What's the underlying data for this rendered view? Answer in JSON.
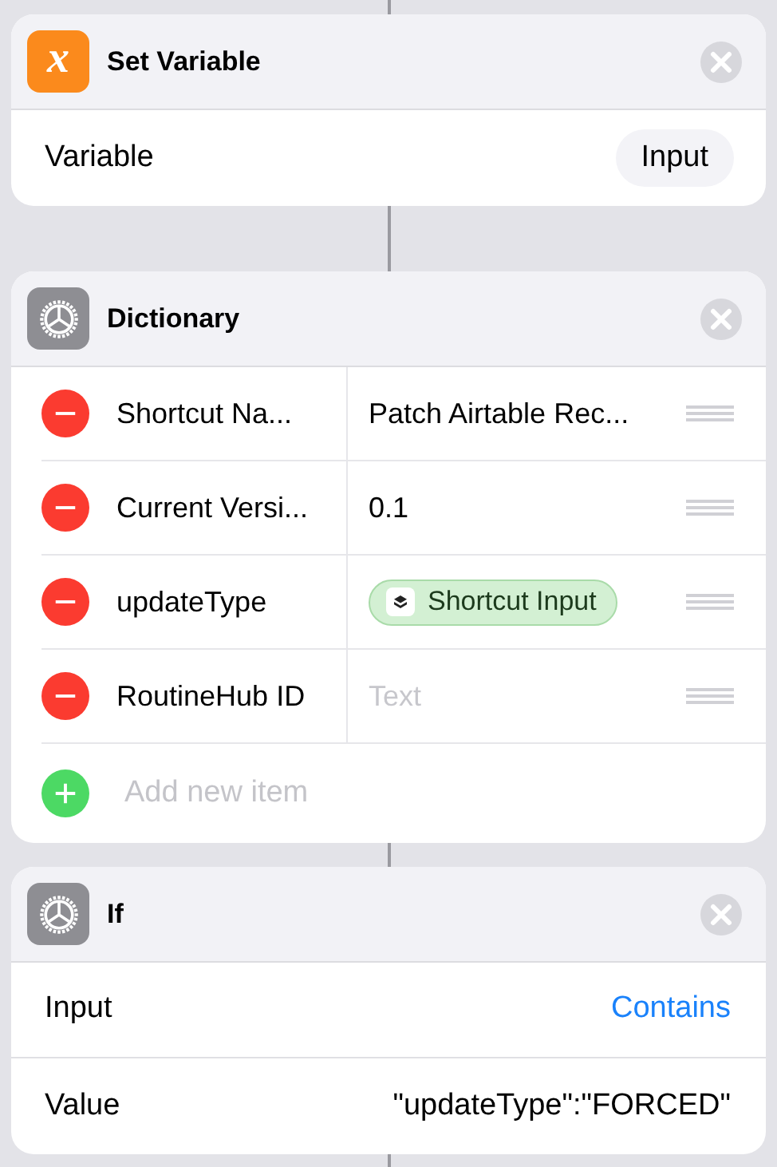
{
  "actions": [
    {
      "title": "Set Variable",
      "kind": "variable",
      "icon_glyph": "x",
      "rows": [
        {
          "label": "Variable",
          "kind": "pill",
          "value": "Input"
        }
      ]
    },
    {
      "title": "Dictionary",
      "kind": "scripting",
      "dictionary": {
        "items": [
          {
            "key": "Shortcut Na...",
            "kind": "text",
            "value": "Patch Airtable Rec..."
          },
          {
            "key": "Current Versi...",
            "kind": "text",
            "value": "0.1"
          },
          {
            "key": "updateType",
            "kind": "variable",
            "value": "Shortcut Input"
          },
          {
            "key": "RoutineHub ID",
            "kind": "empty",
            "placeholder": "Text"
          }
        ],
        "add_label": "Add new item"
      }
    },
    {
      "title": "If",
      "kind": "scripting",
      "rows": [
        {
          "label": "Input",
          "kind": "link",
          "value": "Contains"
        },
        {
          "label": "Value",
          "kind": "text",
          "value": "\"updateType\":\"FORCED\""
        }
      ]
    }
  ]
}
